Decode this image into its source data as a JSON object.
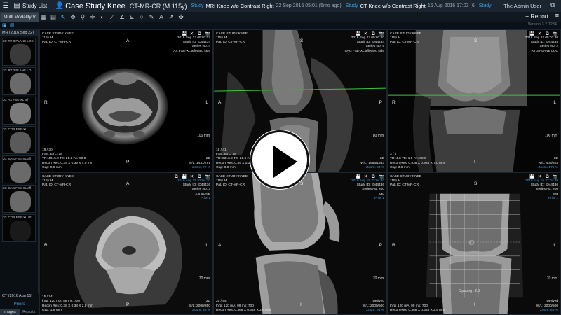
{
  "app": {
    "study_list_label": "Study List",
    "case_title": "Case Study Knee",
    "case_subtitle": "CT-MR-CR (M 115y)",
    "studies": [
      {
        "tag": "Study",
        "name": "MRI Knee w/o Contrast Right",
        "date": "22 Sep 2016 05:01 (5mo ago)"
      },
      {
        "tag": "Study",
        "name": "CT Knee w/o Contrast Right",
        "date": "15 Aug 2016 17:03 (6"
      },
      {
        "tag": "Study",
        "name": "",
        "date": ""
      }
    ],
    "admin_user": "The Admin User",
    "window_button": "⧉"
  },
  "tabs": {
    "active_tab": "Multi Modality Vi..."
  },
  "toolbar": {
    "tools": [
      {
        "icon": "layout-icon",
        "glyph": "▦"
      },
      {
        "icon": "stack-icon",
        "glyph": "▤"
      },
      {
        "icon": "pointer-icon",
        "glyph": "↖"
      },
      {
        "icon": "pan-icon",
        "glyph": "✥"
      },
      {
        "icon": "zoom-icon",
        "glyph": "⚲"
      },
      {
        "icon": "crosshair-icon",
        "glyph": "✛"
      },
      {
        "icon": "window-level-icon",
        "glyph": "◐"
      },
      {
        "icon": "length-icon",
        "glyph": "⟋"
      },
      {
        "icon": "angle-icon",
        "glyph": "∠"
      },
      {
        "icon": "cobb-angle-icon",
        "glyph": "⊾"
      },
      {
        "icon": "ellipse-roi-icon",
        "glyph": "○"
      },
      {
        "icon": "freehand-roi-icon",
        "glyph": "✎"
      },
      {
        "icon": "text-annotation-icon",
        "glyph": "A"
      },
      {
        "icon": "arrow-annotation-icon",
        "glyph": "↗"
      },
      {
        "icon": "reset-icon",
        "glyph": "✣"
      }
    ],
    "report_label": "+ Report",
    "more_label": "≡",
    "version": "Version 3.2.1234"
  },
  "left_panel": {
    "header": "MR (2016 Sep 22)",
    "series": [
      {
        "label": "20: RT 3 PLANE LOC",
        "shape": "slice"
      },
      {
        "label": "20: RT 3 PLANE LO",
        "shape": "knee-sag"
      },
      {
        "label": "20: AX FSE-XL aff",
        "shape": "knee-ax"
      },
      {
        "label": "20: COR FSE-XL",
        "shape": "knee-cor"
      },
      {
        "label": "20: SAG FSE-XL aff",
        "shape": "knee-sag"
      },
      {
        "label": "20: SAG FSE-XL aff",
        "shape": "knee-sag"
      },
      {
        "label": "20: COR FSE-XL aff",
        "shape": "dark"
      }
    ],
    "ct_header": "CT (2016 Aug 15)",
    "priors_label": "Priors",
    "bottom_tabs": [
      "Images",
      "Results"
    ]
  },
  "viewports": [
    {
      "id": "vp1",
      "top_left": [
        "CASE STUDY KNEE",
        "115y  M",
        "Pat. ID: CT-MR-CR"
      ],
      "top_right": [
        "2016 Sep 22  05:07:07",
        "Study ID: ID44434",
        "Series No: 4",
        "AX FSE-XL affected side"
      ],
      "bottom_left": [
        "19 / 30",
        "FSE, ETL: 18",
        "TR: 4615.0  TE: 21.2  FA: 90.0",
        "Recon Res: 0.39 X 0.39 X 4.0 mm",
        "Gap: 0.0 mm"
      ],
      "bottom_right": [
        "2D",
        "W/L: 1431/781",
        "Zoom: 72 %"
      ],
      "scale": "100 mm",
      "orient": {
        "top": "A",
        "left": "R",
        "right": "L",
        "bottom": "P"
      }
    },
    {
      "id": "vp2",
      "top_left": [
        "CASE STUDY KNEE",
        "115y  M",
        "Pat. ID: CT-MR-CR"
      ],
      "top_right": [
        "2016 Sep 22  05:02:20",
        "Study ID: ID44434",
        "Series No: 5",
        "SAG FSE-XL affected side"
      ],
      "bottom_left": [
        "16 / 41",
        "FSE, ETL: 18",
        "TR: 6316.9  TE: 21.6  FA: 90.0",
        "Recon Res: 0.39 X 0.39 X 2.5 mm",
        "Gap: 0.0 mm"
      ],
      "bottom_right": [
        "2D",
        "W/L: 1966/1563",
        "Zoom: 83 %"
      ],
      "scale": "80 mm",
      "orient": {
        "top": "S",
        "left": "A",
        "right": "P",
        "bottom": "I"
      }
    },
    {
      "id": "vp3",
      "top_left": [
        "CASE STUDY KNEE",
        "115y  M",
        "Pat. ID: CT-MR-CR"
      ],
      "top_right": [
        "2016 Sep 22  05:03:30",
        "Study ID: ID44434",
        "Series No: 2",
        "RT 3 PLANE LOC"
      ],
      "bottom_left": [
        "3 / 5",
        "TR: 4.8  TE: 1.5  FA: 30.0",
        "Recon Res: 0.938 X 0.938 X 7.0 mm",
        "Gap: 3.0 mm"
      ],
      "bottom_right": [
        "2D",
        "W/L: 406/203",
        "Zoom: 176 %"
      ],
      "scale": "100 mm",
      "orient": {
        "top": "S",
        "left": "R",
        "right": "L",
        "bottom": "I"
      }
    },
    {
      "id": "vp4",
      "top_left": [
        "CASE STUDY KNEE",
        "115y  M",
        "Pat. ID: CT-MR-CR"
      ],
      "top_right": [
        "2016 Aug 15  22:04:30",
        "Study ID: ID44436",
        "Series No: 3",
        "2.5 BONE",
        "Prior 1"
      ],
      "bottom_left": [
        "15 / 74",
        "kVp: 120  mA: 99  ms: 700",
        "Recon Res: 0.38 X 0.38 X 2.5 mm",
        "Gap: 1.9 mm"
      ],
      "bottom_right": [
        "2D",
        "W/L: 2000/350",
        "Zoom: 88 %"
      ],
      "scale": "70 mm",
      "orient": {
        "top": "A",
        "left": "R",
        "right": "L",
        "bottom": "P"
      }
    },
    {
      "id": "vp5",
      "top_left": [
        "CASE STUDY KNEE",
        "115y  M",
        "Pat. ID: CT-MR-CR"
      ],
      "top_right": [
        "2016 Aug 15  22:04:30",
        "Study ID: ID44436",
        "Series No: 200",
        "sag",
        "Prior 1"
      ],
      "bottom_left": [
        "20 / 54",
        "kVp: 120  mA: 99  ms: 700",
        "Recon Res: 0.368 X 0.368 X 2.5 mm"
      ],
      "bottom_right": [
        "Derived",
        "W/L: 2000/500",
        "Zoom: 88 %"
      ],
      "scale": "70 mm",
      "orient": {
        "top": "S",
        "left": "A",
        "right": "P",
        "bottom": "I"
      }
    },
    {
      "id": "vp6",
      "top_left": [
        "CASE STUDY KNEE",
        "115y  M",
        "Pat. ID: CT-MR-CR"
      ],
      "top_right": [
        "2016 Aug 15  22:04:30",
        "Study ID: ID44436",
        "Series No: 200",
        "seg",
        "Prior 1"
      ],
      "bottom_left": [
        "kVp: 120  mA: 99  ms: 700",
        "Recon Res: 0.368 X 0.368 X 2.5 mm"
      ],
      "bottom_right": [
        "Derived",
        "W/L: 2000/500",
        "Zoom: 88 %"
      ],
      "scale": "70 mm",
      "spacing_label": "Spacing : 2.5",
      "orient": {
        "top": "S",
        "left": "R",
        "right": "L",
        "bottom": "I"
      }
    }
  ]
}
